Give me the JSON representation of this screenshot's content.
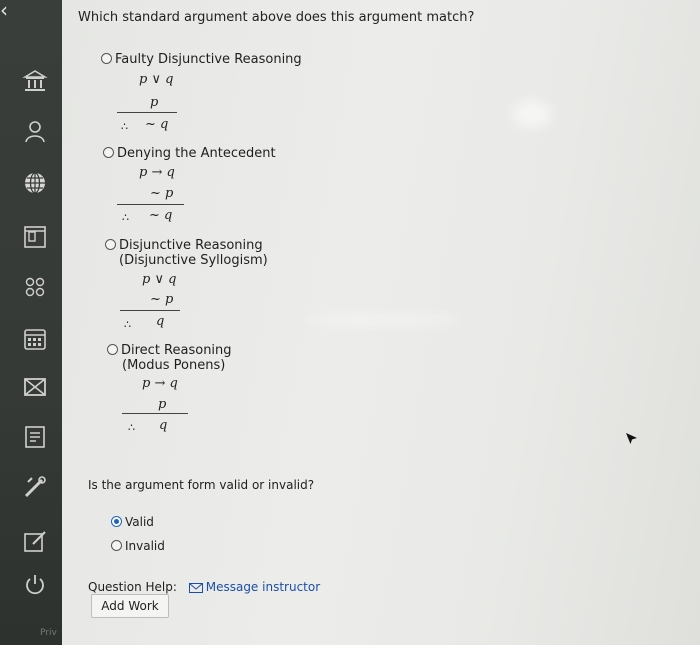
{
  "question": "Which standard argument above does this argument match?",
  "options": [
    {
      "label1": "Faulty Disjunctive Reasoning",
      "label2": "",
      "premise1": "p ∨ q",
      "premise2": "p",
      "conclusion": "~ q",
      "selected": false
    },
    {
      "label1": "Denying the Antecedent",
      "label2": "",
      "premise1": "p → q",
      "premise2": "~ p",
      "conclusion": "~ q",
      "selected": false
    },
    {
      "label1": "Disjunctive Reasoning",
      "label2": "(Disjunctive Syllogism)",
      "premise1": "p ∨ q",
      "premise2": "~ p",
      "conclusion": "q",
      "selected": false
    },
    {
      "label1": "Direct Reasoning",
      "label2": "(Modus Ponens)",
      "premise1": "p → q",
      "premise2": "p",
      "conclusion": "q",
      "selected": false
    }
  ],
  "therefore_symbol": "∴",
  "validity_question": "Is the argument form valid or invalid?",
  "validity_options": [
    {
      "label": "Valid",
      "selected": true
    },
    {
      "label": "Invalid",
      "selected": false
    }
  ],
  "help": {
    "label": "Question Help:",
    "message_link": "Message instructor"
  },
  "add_work_label": "Add Work",
  "sidebar_footer": "Priv",
  "colors": {
    "sidebar": "#363a36",
    "accent": "#1e63c4",
    "link": "#1b4fa6"
  }
}
